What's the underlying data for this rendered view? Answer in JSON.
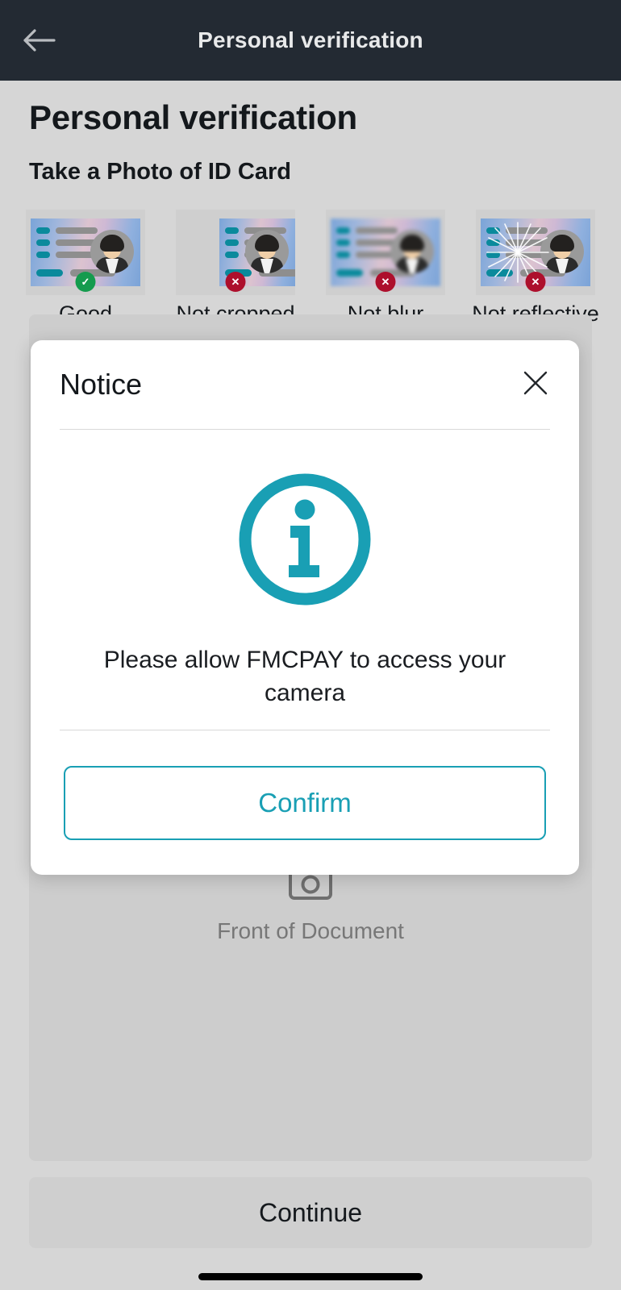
{
  "appbar": {
    "back_icon": "arrow-left-icon",
    "title": "Personal verification"
  },
  "page": {
    "title": "Personal verification",
    "section_title": "Take a Photo of ID Card"
  },
  "examples": [
    {
      "label": "Good",
      "status": "ok",
      "badge_glyph": "✓",
      "variant": "good"
    },
    {
      "label": "Not cropped",
      "status": "bad",
      "badge_glyph": "✕",
      "variant": "cropped"
    },
    {
      "label": "Not blur",
      "status": "bad",
      "badge_glyph": "✕",
      "variant": "blur"
    },
    {
      "label": "Not reflective",
      "status": "bad",
      "badge_glyph": "✕",
      "variant": "reflective"
    }
  ],
  "upload": {
    "icon": "camera-icon",
    "label": "Front of\nDocument"
  },
  "footer": {
    "continue_label": "Continue"
  },
  "modal": {
    "title": "Notice",
    "close_icon": "close-icon",
    "info_icon": "info-circle-icon",
    "message": "Please allow FMCPAY to access your camera",
    "confirm_label": "Confirm"
  },
  "colors": {
    "appbar_bg": "#232a33",
    "page_bg": "#d6d6d6",
    "accent_teal": "#199fb4",
    "badge_ok_green": "#159b4e",
    "badge_bad_red": "#ad0f2c",
    "card_surface": "#cdcdcd",
    "muted_text": "#777777"
  }
}
